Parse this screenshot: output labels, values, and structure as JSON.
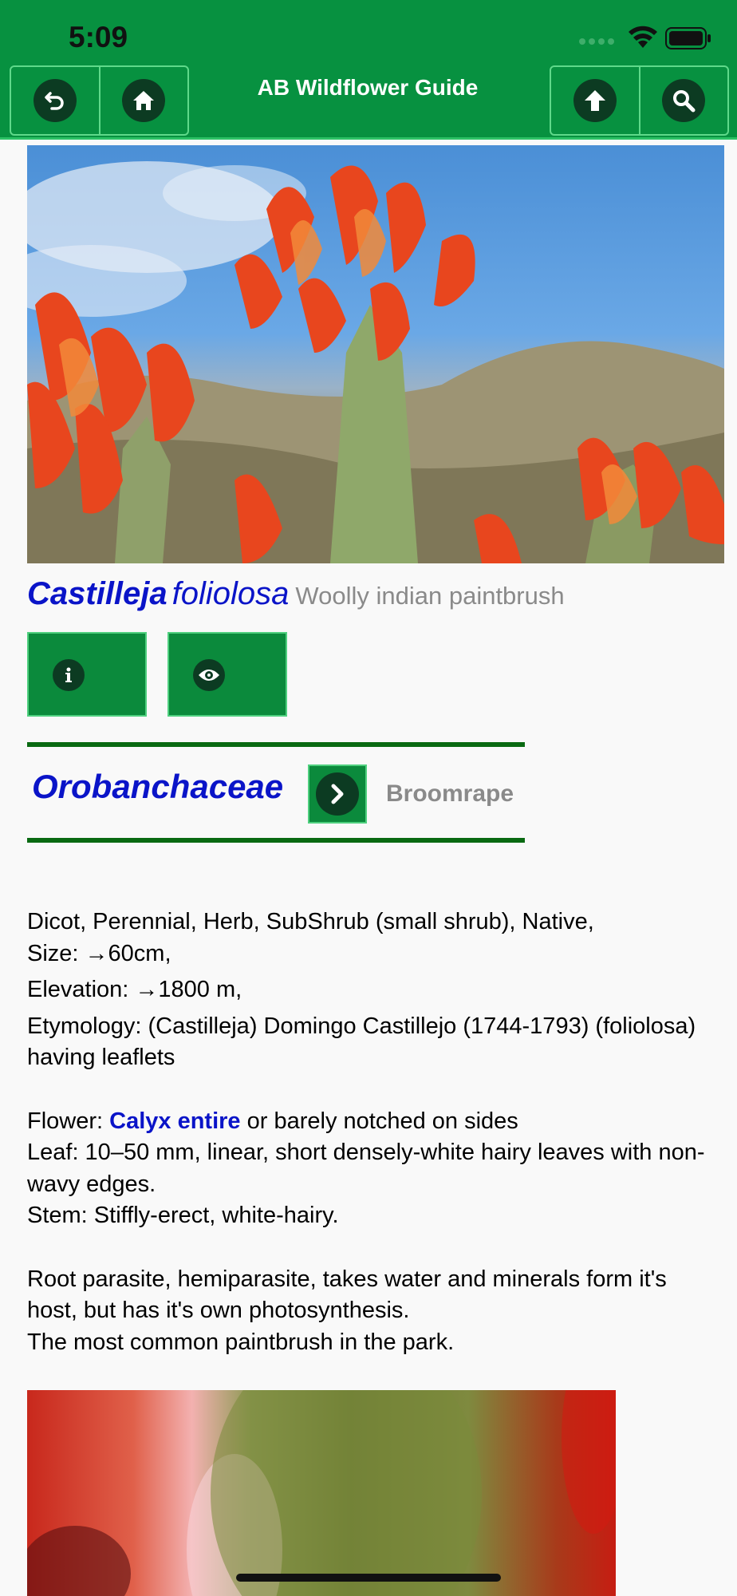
{
  "status": {
    "time": "5:09"
  },
  "header": {
    "title": "AB Wildflower Guide",
    "colors": {
      "bar": "#079140",
      "button_circle": "#0c3b22"
    }
  },
  "plant": {
    "genus": "Castilleja",
    "species": "foliolosa",
    "common_name": "Woolly indian paintbrush"
  },
  "family": {
    "name": "Orobanchaceae",
    "common_name": "Broomrape"
  },
  "description": {
    "line1": "Dicot, Perennial, Herb, SubShrub (small shrub), Native,",
    "size": "Size: →60cm,",
    "elevation": "Elevation: →1800 m,",
    "etymology": "Etymology: (Castilleja) Domingo Castillejo (1744-1793) (foliolosa) having leaflets",
    "flower_prefix": "Flower: ",
    "flower_link": "Calyx entire",
    "flower_suffix": " or barely notched on sides",
    "leaf": "Leaf: 10–50 mm, linear, short densely-white hairy leaves with non-wavy edges.",
    "stem": "Stem: Stiffly-erect, white-hairy.",
    "note1": "Root parasite, hemiparasite, takes water and minerals form it's host, but has it's own photosynthesis.",
    "note2": "The most common paintbrush in the park."
  },
  "icons": {
    "back": "undo-arrow-icon",
    "home": "home-icon",
    "up": "arrow-up-icon",
    "search": "search-icon",
    "info": "info-icon",
    "view": "eye-icon",
    "family_next": "chevron-right-icon"
  }
}
